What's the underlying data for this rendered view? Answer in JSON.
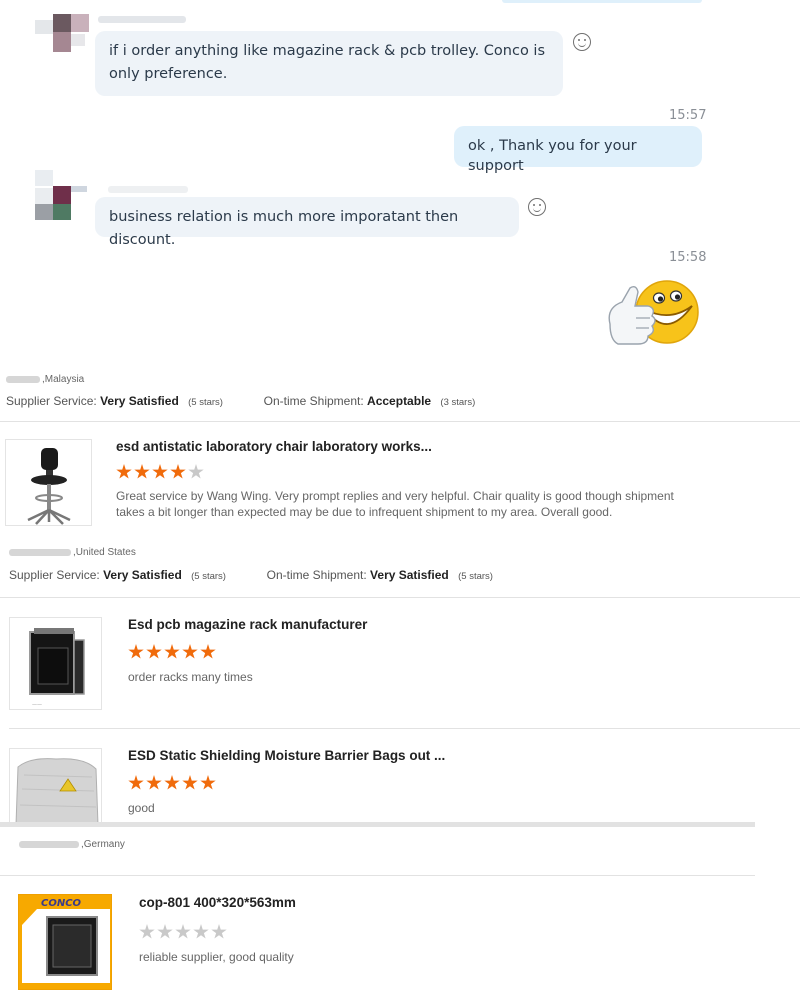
{
  "chat": {
    "messages": [
      {
        "text": "if i order anything like magazine rack & pcb trolley. Conco is only preference."
      },
      {
        "time": "15:57"
      },
      {
        "text": "ok , Thank you for your support"
      },
      {
        "text": "business relation is much more imporatant then discount."
      },
      {
        "time": "15:58"
      }
    ],
    "sticker": "thumbs-up-grin-emoji"
  },
  "reviews": [
    {
      "country": "Malaysia",
      "supplier_service_label": "Supplier Service:",
      "supplier_service_value": "Very Satisfied",
      "supplier_service_stars": "(5 stars)",
      "shipment_label": "On-time Shipment:",
      "shipment_value": "Acceptable",
      "shipment_stars": "(3 stars)",
      "products": [
        {
          "title": "esd antistatic laboratory chair laboratory works...",
          "rating": 4,
          "comment": "Great service by Wang Wing. Very prompt replies and very helpful. Chair quality is good though shipment takes a bit longer than expected may be due to infrequent shipment to my area. Overall good."
        }
      ]
    },
    {
      "country": "United States",
      "supplier_service_label": "Supplier Service:",
      "supplier_service_value": "Very Satisfied",
      "supplier_service_stars": "(5 stars)",
      "shipment_label": "On-time Shipment:",
      "shipment_value": "Very Satisfied",
      "shipment_stars": "(5 stars)",
      "products": [
        {
          "title": "Esd pcb magazine rack manufacturer",
          "rating": 5,
          "comment": "order racks many times"
        },
        {
          "title": "ESD Static Shielding Moisture Barrier Bags out ...",
          "rating": 5,
          "comment": "good"
        }
      ]
    },
    {
      "country": "Germany",
      "products": [
        {
          "title": "cop-801 400*320*563mm",
          "rating": 0,
          "comment": "reliable supplier, good quality",
          "logo_text": "CONCO"
        }
      ]
    }
  ],
  "colors": {
    "star_on": "#f06b0c",
    "star_off": "#c9c9c9",
    "bubble_in": "#eef3f8",
    "bubble_out": "#dff0fb"
  }
}
